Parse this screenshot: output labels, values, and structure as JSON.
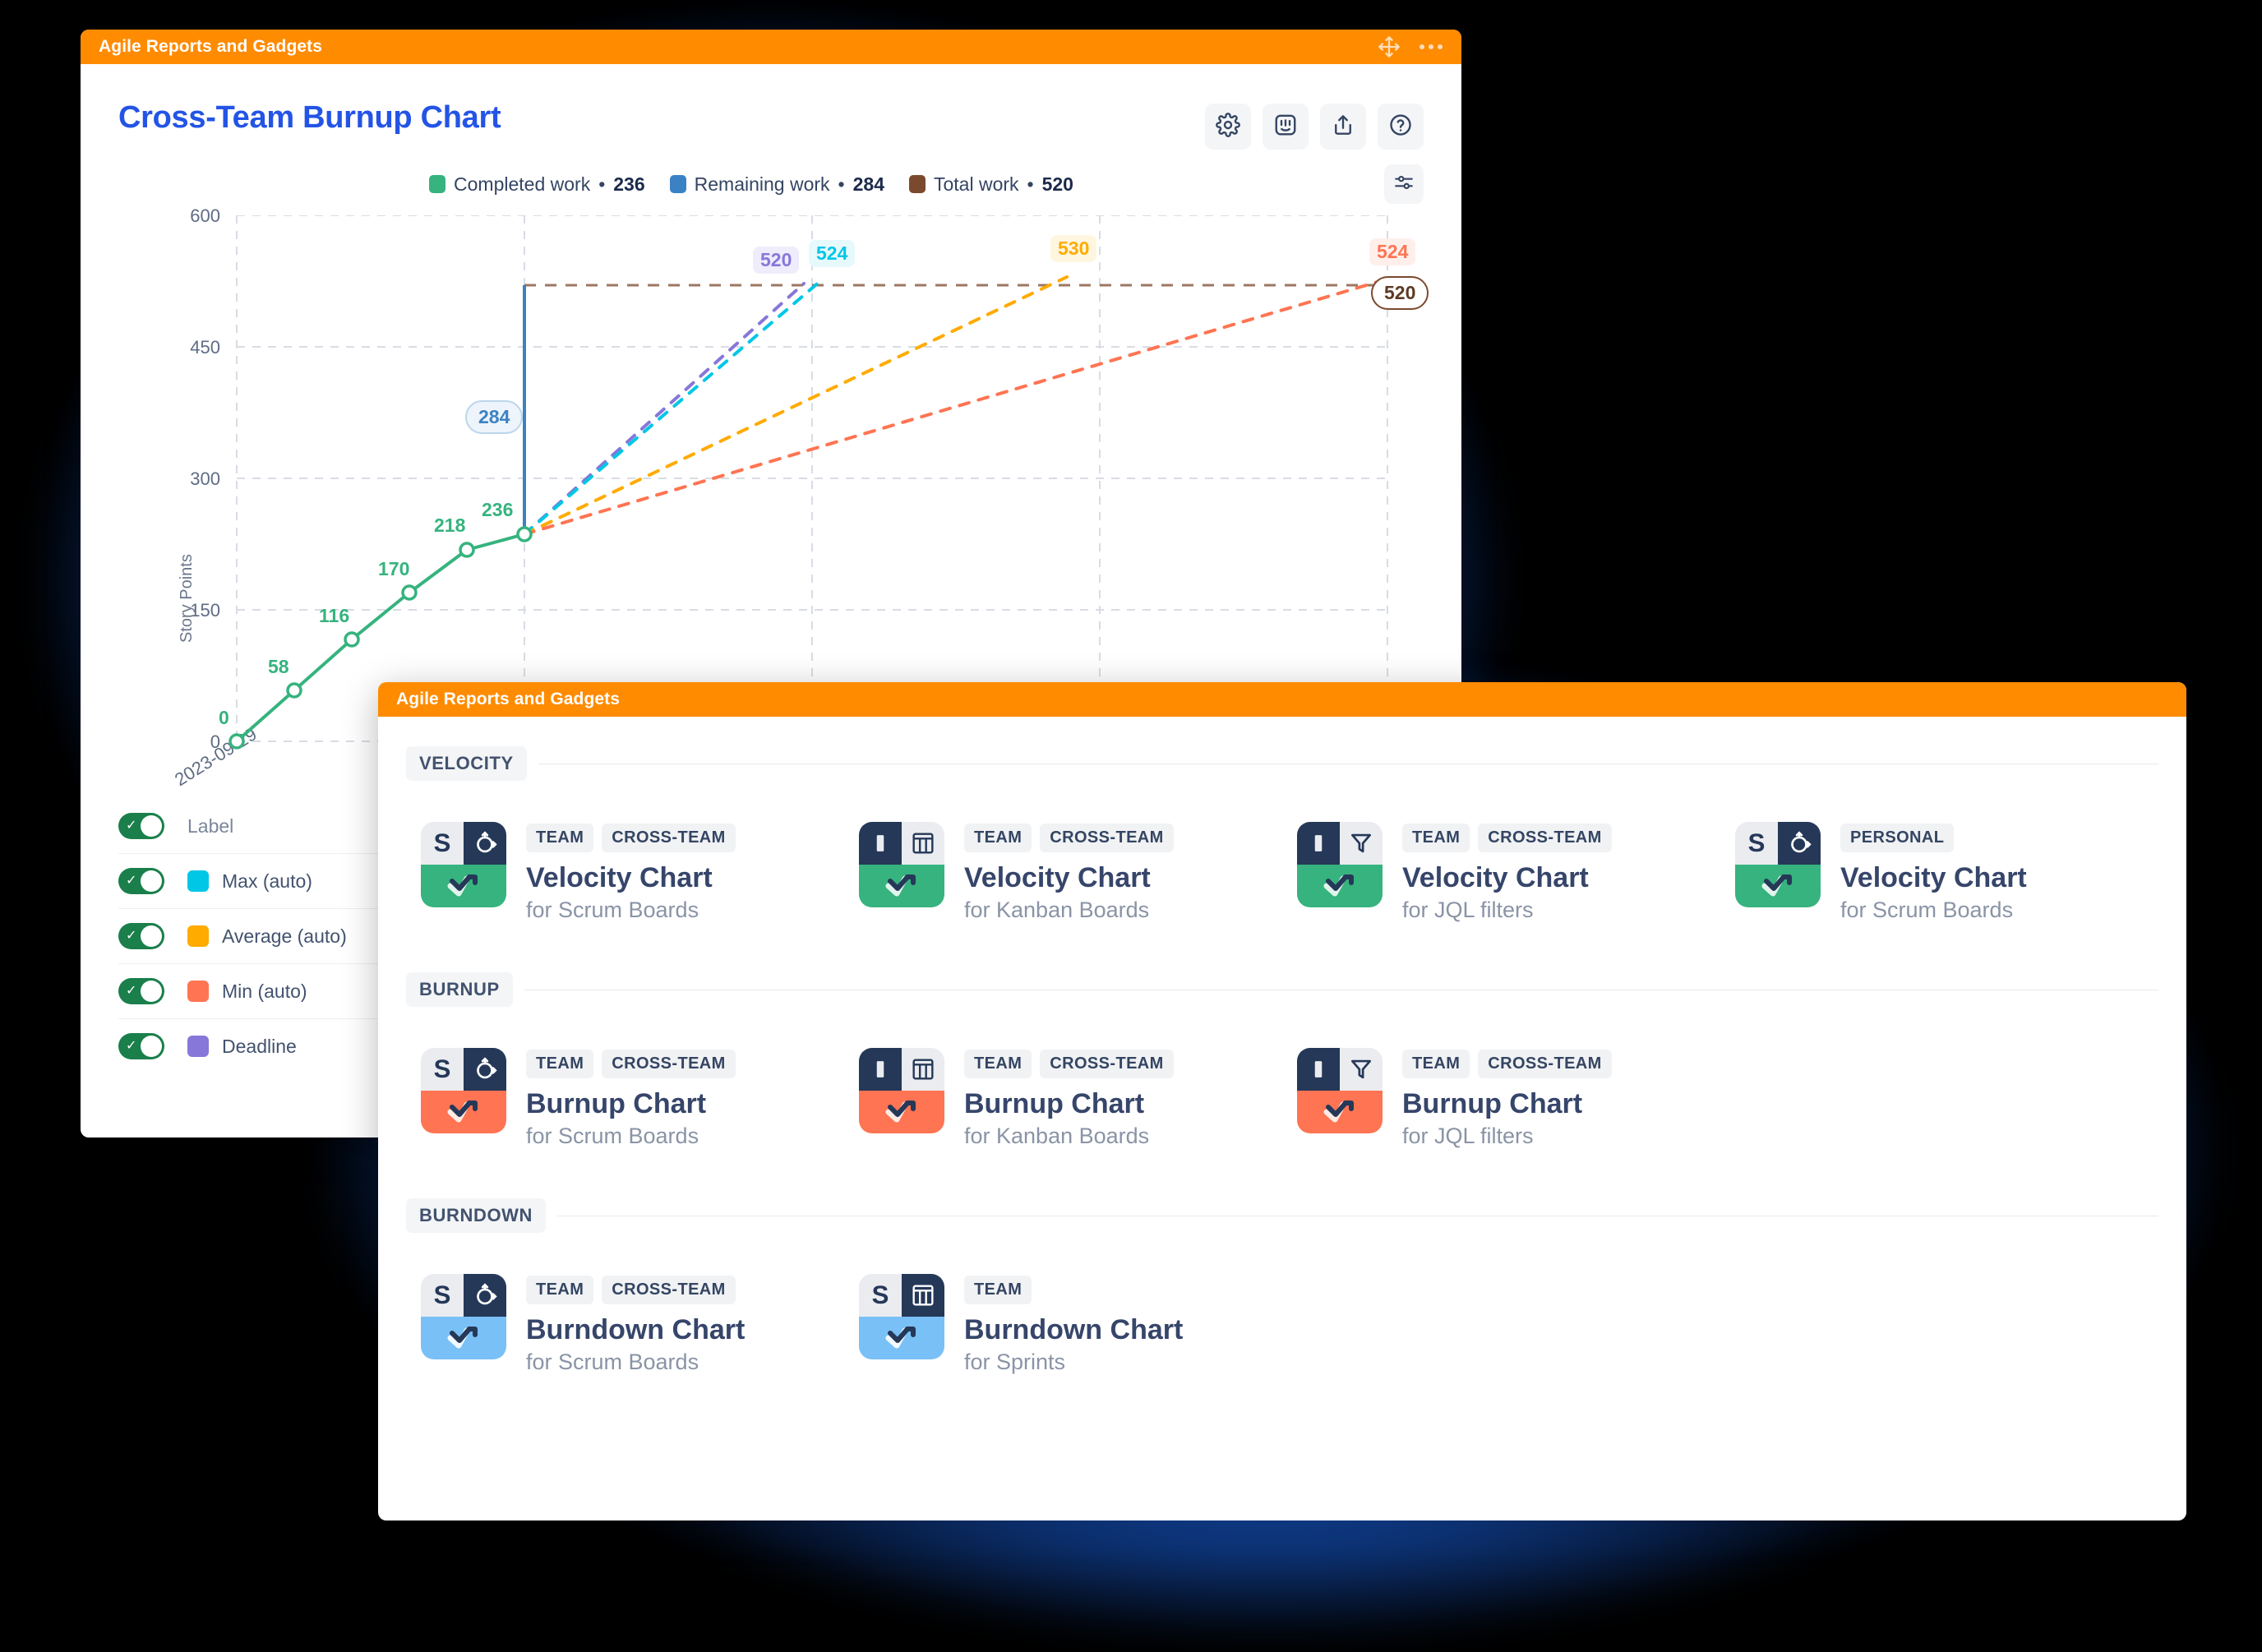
{
  "window_chart": {
    "titlebar": {
      "title": "Agile Reports and Gadgets",
      "move_icon": "move-icon",
      "menu_icon": "ellipsis-icon"
    },
    "title": "Cross-Team Burnup Chart",
    "header_buttons": [
      {
        "name": "settings-button",
        "icon": "gear-icon"
      },
      {
        "name": "support-button",
        "icon": "intercom-face-icon"
      },
      {
        "name": "share-button",
        "icon": "share-upload-icon"
      },
      {
        "name": "help-button",
        "icon": "question-circle-icon"
      }
    ],
    "filter_button": {
      "name": "chart-filter-button",
      "icon": "sliders-icon"
    },
    "legend": [
      {
        "label": "Completed work",
        "value": "236",
        "color": "#36B37E"
      },
      {
        "label": "Remaining work",
        "value": "284",
        "color": "#3B82C4"
      },
      {
        "label": "Total work",
        "value": "520",
        "color": "#7B4A2E"
      }
    ],
    "toggles": [
      {
        "label": "Label",
        "on": true,
        "color": null
      },
      {
        "label": "Max (auto)",
        "on": true,
        "color": "#00C7E6"
      },
      {
        "label": "Average (auto)",
        "on": true,
        "color": "#FFAB00"
      },
      {
        "label": "Min (auto)",
        "on": true,
        "color": "#FF7452"
      },
      {
        "label": "Deadline",
        "on": true,
        "color": "#8777D9"
      }
    ]
  },
  "chart_data": {
    "type": "line",
    "title": "Cross-Team Burnup Chart",
    "xlabel": "",
    "ylabel": "Story Points",
    "ylim": [
      0,
      600
    ],
    "yticks": [
      0,
      150,
      300,
      450,
      600
    ],
    "xticks": [
      "2023-09-29"
    ],
    "grid": true,
    "legend_position": "top-center",
    "series": [
      {
        "name": "Completed work",
        "color": "#36B37E",
        "style": "solid",
        "values": [
          0,
          58,
          116,
          170,
          218,
          236
        ],
        "point_labels": [
          "0",
          "58",
          "116",
          "170",
          "218",
          "236"
        ]
      },
      {
        "name": "Remaining work",
        "color": "#3B82C4",
        "style": "vertical-bar",
        "from": 236,
        "to": 520,
        "label": "284"
      },
      {
        "name": "Total work",
        "color": "#7B4A2E",
        "style": "dashed-horizontal",
        "value": 520,
        "label": "520"
      },
      {
        "name": "Deadline",
        "color": "#8777D9",
        "style": "dashed",
        "end_value": 520,
        "label": "520"
      },
      {
        "name": "Max (auto)",
        "color": "#00C7E6",
        "style": "dashed",
        "end_value": 524,
        "label": "524"
      },
      {
        "name": "Average (auto)",
        "color": "#FFAB00",
        "style": "dashed",
        "end_value": 530,
        "label": "530"
      },
      {
        "name": "Min (auto)",
        "color": "#FF7452",
        "style": "dashed",
        "end_value": 524,
        "label": "524"
      }
    ]
  },
  "window_gadgets": {
    "titlebar": {
      "title": "Agile Reports and Gadgets"
    },
    "sections": [
      {
        "name": "VELOCITY",
        "accent": "#36B37E",
        "cards": [
          {
            "tags": [
              "TEAM",
              "CROSS-TEAM"
            ],
            "title": "Velocity Chart",
            "subtitle": "for Scrum Boards",
            "icon": "scrum-board-icon"
          },
          {
            "tags": [
              "TEAM",
              "CROSS-TEAM"
            ],
            "title": "Velocity Chart",
            "subtitle": "for Kanban Boards",
            "icon": "kanban-board-icon"
          },
          {
            "tags": [
              "TEAM",
              "CROSS-TEAM"
            ],
            "title": "Velocity Chart",
            "subtitle": "for JQL filters",
            "icon": "jql-filter-icon"
          },
          {
            "tags": [
              "PERSONAL"
            ],
            "title": "Velocity Chart",
            "subtitle": "for Scrum Boards",
            "icon": "scrum-board-icon"
          }
        ]
      },
      {
        "name": "BURNUP",
        "accent": "#FF7452",
        "cards": [
          {
            "tags": [
              "TEAM",
              "CROSS-TEAM"
            ],
            "title": "Burnup Chart",
            "subtitle": "for Scrum Boards",
            "icon": "scrum-board-icon"
          },
          {
            "tags": [
              "TEAM",
              "CROSS-TEAM"
            ],
            "title": "Burnup Chart",
            "subtitle": "for Kanban Boards",
            "icon": "kanban-board-icon"
          },
          {
            "tags": [
              "TEAM",
              "CROSS-TEAM"
            ],
            "title": "Burnup Chart",
            "subtitle": "for JQL filters",
            "icon": "jql-filter-icon"
          }
        ]
      },
      {
        "name": "BURNDOWN",
        "accent": "#79C0F7",
        "cards": [
          {
            "tags": [
              "TEAM",
              "CROSS-TEAM"
            ],
            "title": "Burndown Chart",
            "subtitle": "for Scrum Boards",
            "icon": "scrum-board-icon"
          },
          {
            "tags": [
              "TEAM"
            ],
            "title": "Burndown Chart",
            "subtitle": "for Sprints",
            "icon": "sprint-grid-icon"
          }
        ]
      }
    ]
  }
}
